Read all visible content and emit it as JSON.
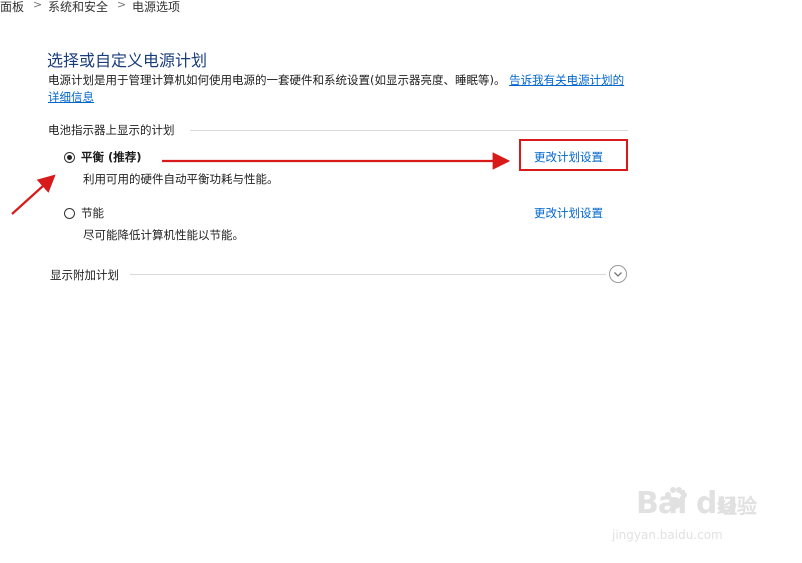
{
  "breadcrumb": {
    "items": [
      "面板",
      "系统和安全",
      "电源选项"
    ],
    "separator": ">"
  },
  "page": {
    "title": "选择或自定义电源计划",
    "description": "电源计划是用于管理计算机如何使用电源的一套硬件和系统设置(如显示器亮度、睡眠等)。",
    "learn_more_link": "告诉我有关电源计划的详细信息"
  },
  "battery_plans": {
    "group_label": "电池指示器上显示的计划",
    "plans": [
      {
        "name": "平衡 (推荐)",
        "description": "利用可用的硬件自动平衡功耗与性能。",
        "selected": true,
        "change_link": "更改计划设置"
      },
      {
        "name": "节能",
        "description": "尽可能降低计算机性能以节能。",
        "selected": false,
        "change_link": "更改计划设置"
      }
    ]
  },
  "additional_plans": {
    "label": "显示附加计划",
    "expand_icon": "chevron-down-icon"
  },
  "annotations": {
    "arrow_color": "#d91a1a",
    "highlight_color": "#d91a1a"
  },
  "watermark": {
    "brand": "Bai du",
    "brand_cn": "经验",
    "url": "jingyan.baidu.com"
  }
}
